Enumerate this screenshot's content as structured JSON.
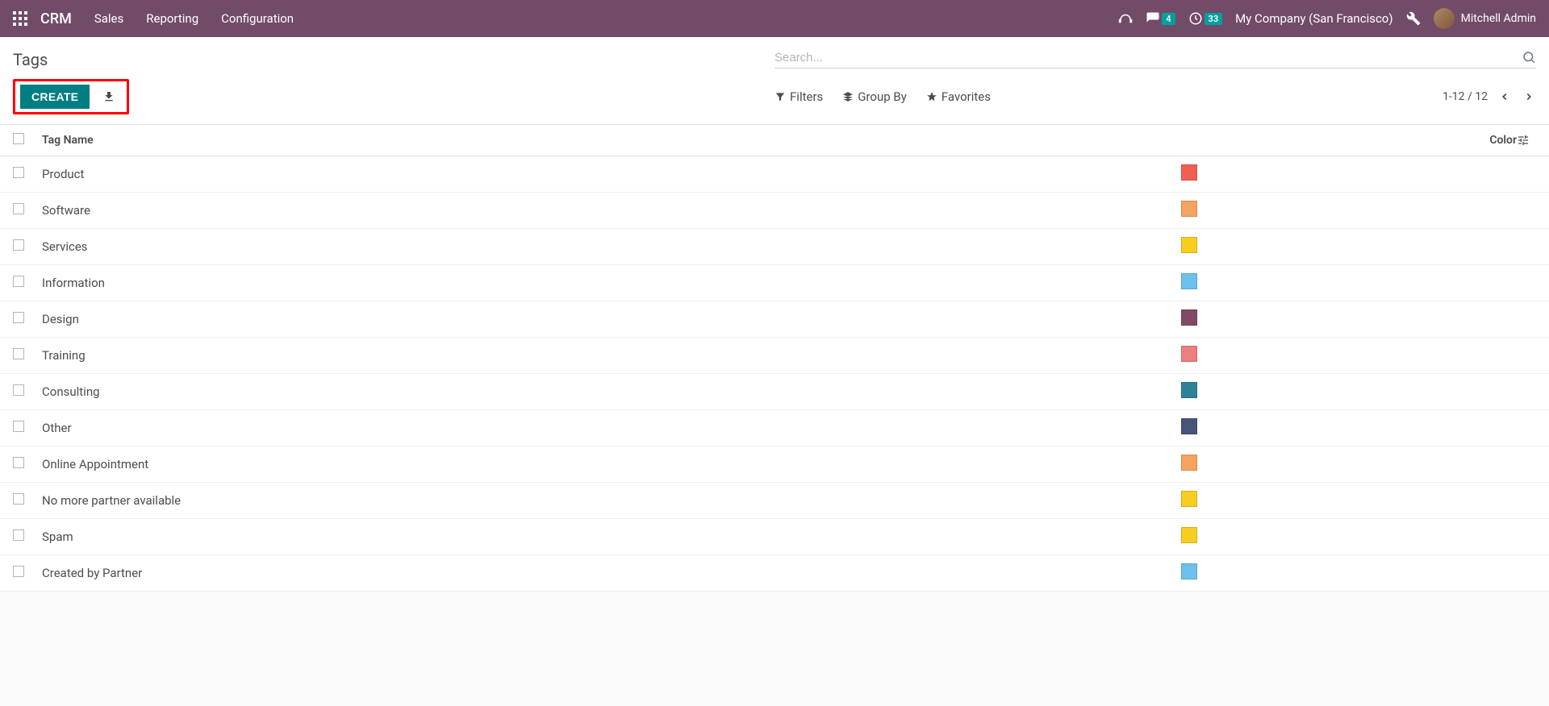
{
  "navbar": {
    "brand": "CRM",
    "menu": [
      "Sales",
      "Reporting",
      "Configuration"
    ],
    "messages_count": "4",
    "activities_count": "33",
    "company": "My Company (San Francisco)",
    "user": "Mitchell Admin"
  },
  "cp": {
    "title": "Tags",
    "create_label": "CREATE",
    "search_placeholder": "Search...",
    "filters_label": "Filters",
    "groupby_label": "Group By",
    "favorites_label": "Favorites",
    "pager": "1-12 / 12"
  },
  "table": {
    "header_name": "Tag Name",
    "header_color": "Color",
    "rows": [
      {
        "name": "Product",
        "color": "#F06050"
      },
      {
        "name": "Software",
        "color": "#F4A460"
      },
      {
        "name": "Services",
        "color": "#F7CD1F"
      },
      {
        "name": "Information",
        "color": "#6CC1ED"
      },
      {
        "name": "Design",
        "color": "#814968"
      },
      {
        "name": "Training",
        "color": "#EB7E7F"
      },
      {
        "name": "Consulting",
        "color": "#2C8397"
      },
      {
        "name": "Other",
        "color": "#475577"
      },
      {
        "name": "Online Appointment",
        "color": "#F4A460"
      },
      {
        "name": "No more partner available",
        "color": "#F7CD1F"
      },
      {
        "name": "Spam",
        "color": "#F7CD1F"
      },
      {
        "name": "Created by Partner",
        "color": "#6CC1ED"
      }
    ]
  }
}
